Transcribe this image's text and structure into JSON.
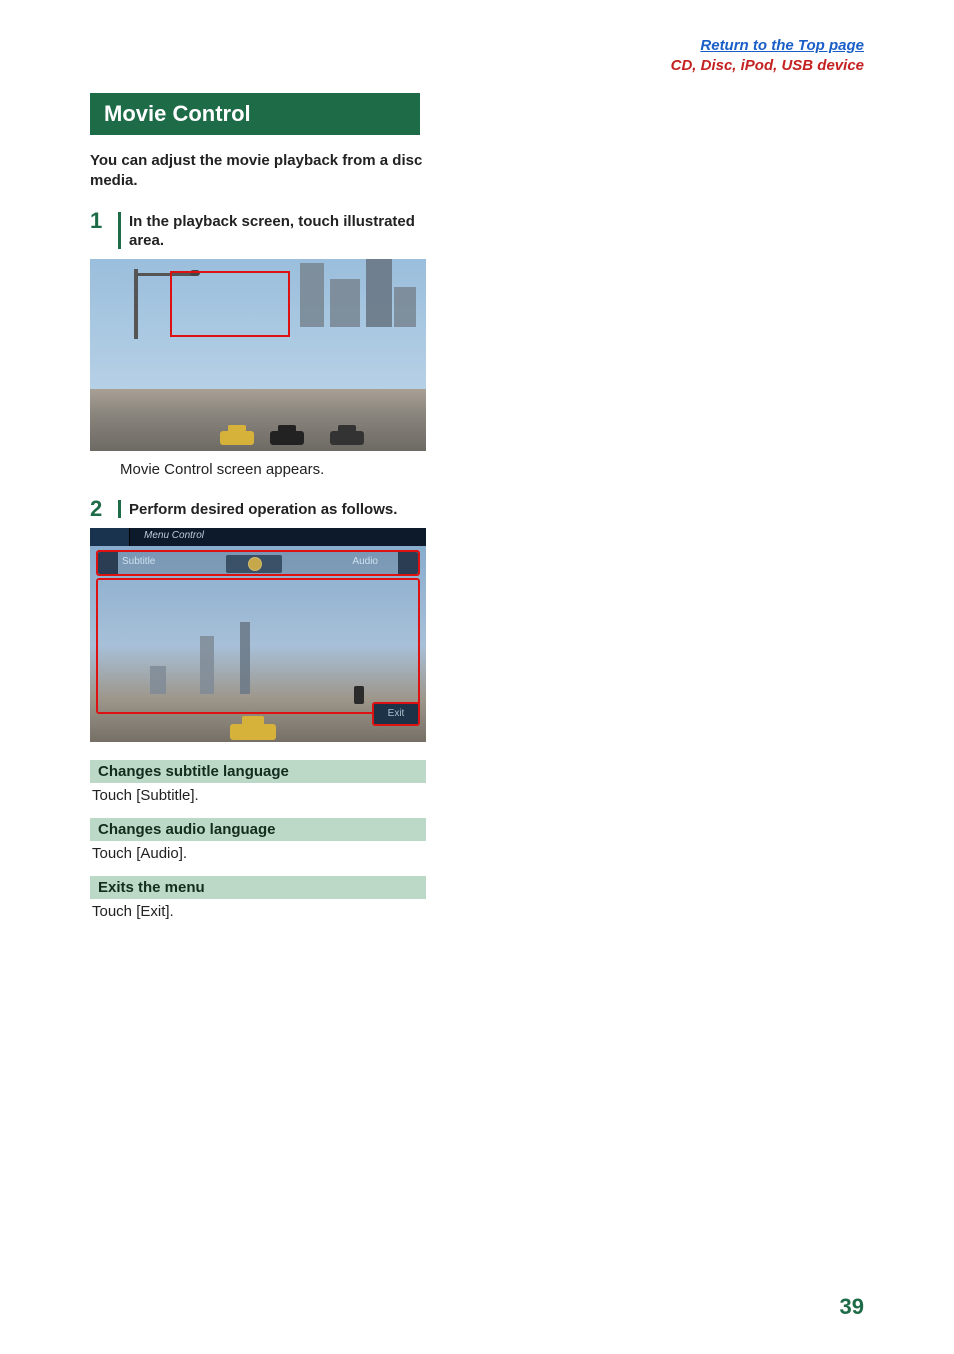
{
  "top": {
    "return_link": "Return to the Top page",
    "breadcrumb": "CD, Disc, iPod, USB device"
  },
  "section_title": "Movie Control",
  "intro": "You can adjust the movie playback from a disc media.",
  "steps": {
    "s1_num": "1",
    "s1_text": "In the playback screen, touch illustrated area.",
    "s1_caption": "Movie Control screen appears.",
    "s2_num": "2",
    "s2_text": "Perform desired operation as follows."
  },
  "shot2": {
    "menubar": "Menu Control",
    "subtitle_label": "Subtitle",
    "audio_label": "Audio",
    "exit_label": "Exit"
  },
  "rows": {
    "h1": "Changes subtitle language",
    "b1": "Touch [Subtitle].",
    "h2": "Changes audio language",
    "b2": "Touch [Audio].",
    "h3": "Exits the menu",
    "b3": "Touch [Exit]."
  },
  "page_number": "39"
}
